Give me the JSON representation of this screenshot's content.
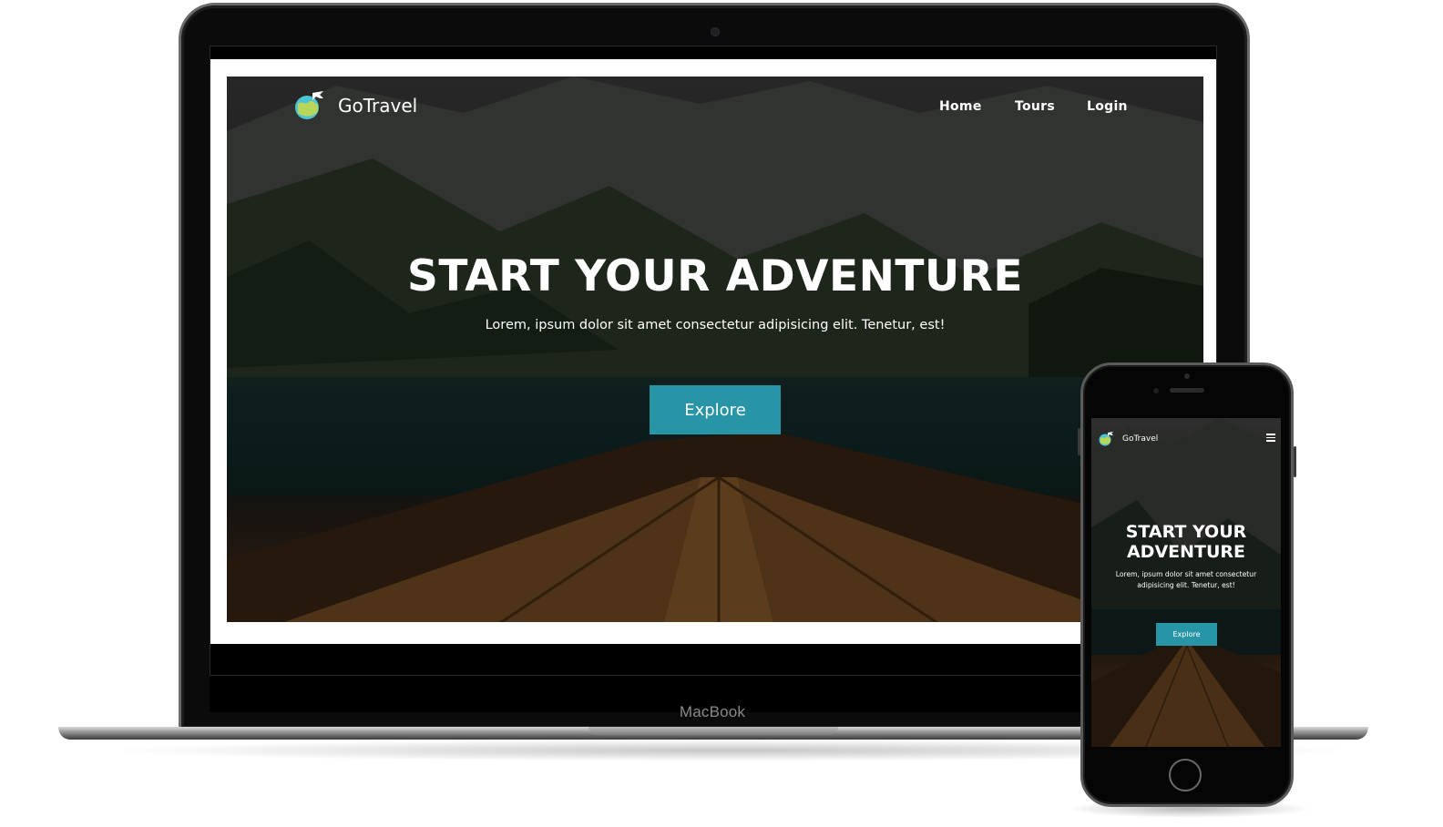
{
  "laptop": {
    "label": "MacBook"
  },
  "site": {
    "brand": "GoTravel",
    "nav": [
      {
        "label": "Home"
      },
      {
        "label": "Tours"
      },
      {
        "label": "Login"
      }
    ],
    "hero": {
      "title": "START YOUR ADVENTURE",
      "subtitle": "Lorem, ipsum dolor sit amet consectetur adipisicing elit. Tenetur, est!",
      "cta": "Explore"
    }
  },
  "mobile": {
    "brand": "GoTravel",
    "title_line1": "START YOUR",
    "title_line2": "ADVENTURE",
    "subtitle_line1": "Lorem, ipsum dolor sit amet consectetur",
    "subtitle_line2": "adipisicing elit. Tenetur, est!",
    "cta": "Explore",
    "menu_icon": "hamburger-icon"
  },
  "colors": {
    "accent": "#2795a6",
    "text": "#ffffff"
  }
}
